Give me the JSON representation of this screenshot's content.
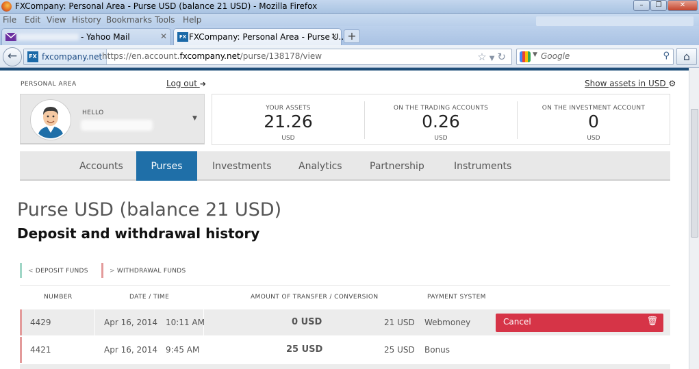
{
  "window": {
    "title": "FXCompany: Personal Area - Purse USD (balance 21 USD) - Mozilla Firefox"
  },
  "menu": [
    "File",
    "Edit",
    "View",
    "History",
    "Bookmarks",
    "Tools",
    "Help"
  ],
  "tabs": [
    {
      "label": "- Yahoo Mail",
      "icon": "yahoo-mail-icon",
      "active": false
    },
    {
      "label": "FXCompany: Personal Area - Purse U...",
      "icon": "fx-favicon",
      "active": true
    }
  ],
  "addressbar": {
    "site_identity": "fxcompany.net",
    "url_prefix": "https://en.account.",
    "url_domain": "fxcompany.net",
    "url_path": "/purse/138178/view"
  },
  "searchbar": {
    "placeholder": "Google"
  },
  "header": {
    "personal_area": "PERSONAL AREA",
    "logout": "Log out",
    "show_assets": "Show assets in USD",
    "hello": "HELLO"
  },
  "assets": [
    {
      "caption": "YOUR ASSETS",
      "value": "21.26",
      "unit": "USD"
    },
    {
      "caption": "ON THE TRADING ACCOUNTS",
      "value": "0.26",
      "unit": "USD"
    },
    {
      "caption": "ON THE INVESTMENT ACCOUNT",
      "value": "0",
      "unit": "USD"
    }
  ],
  "nav": [
    "Accounts",
    "Purses",
    "Investments",
    "Analytics",
    "Partnership",
    "Instruments"
  ],
  "nav_active": "Purses",
  "page": {
    "title": "Purse USD (balance 21 USD)",
    "subtitle": "Deposit and withdrawal history"
  },
  "actions": {
    "deposit": "DEPOSIT FUNDS",
    "withdrawal": "WITHDRAWAL FUNDS"
  },
  "table": {
    "headers": [
      "NUMBER",
      "DATE / TIME",
      "AMOUNT OF TRANSFER / CONVERSION",
      "PAYMENT SYSTEM"
    ],
    "rows": [
      {
        "number": "4429",
        "date": "Apr 16, 2014",
        "time": "10:11 AM",
        "amount": "0 USD",
        "conversion": "21 USD",
        "system": "Webmoney",
        "action": "Cancel"
      },
      {
        "number": "4421",
        "date": "Apr 16, 2014",
        "time": "9:45 AM",
        "amount": "25 USD",
        "conversion": "25 USD",
        "system": "Bonus",
        "action": ""
      }
    ]
  },
  "colors": {
    "brand_blue": "#1f6fa8",
    "cancel_red": "#d63447",
    "deposit_bar": "#9fd6c6",
    "withdrawal_bar": "#e39a9a"
  }
}
